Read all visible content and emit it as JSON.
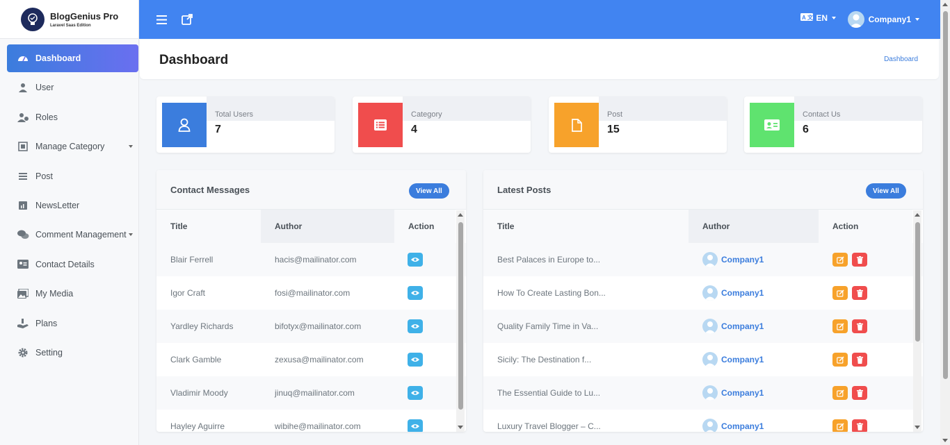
{
  "brand": {
    "name": "BlogGenius Pro",
    "subtitle": "Laravel Saas Edition"
  },
  "sidebar": {
    "items": [
      {
        "label": "Dashboard",
        "icon": "dashboard-icon",
        "active": true
      },
      {
        "label": "User",
        "icon": "user-icon"
      },
      {
        "label": "Roles",
        "icon": "roles-icon"
      },
      {
        "label": "Manage Category",
        "icon": "category-icon",
        "dropdown": true
      },
      {
        "label": "Post",
        "icon": "post-icon"
      },
      {
        "label": "NewsLetter",
        "icon": "newsletter-icon"
      },
      {
        "label": "Comment Management",
        "icon": "comments-icon",
        "dropdown": true
      },
      {
        "label": "Contact Details",
        "icon": "contact-card-icon"
      },
      {
        "label": "My Media",
        "icon": "media-icon"
      },
      {
        "label": "Plans",
        "icon": "plans-icon"
      },
      {
        "label": "Setting",
        "icon": "gear-icon"
      }
    ]
  },
  "header": {
    "language": "EN",
    "user_name": "Company1"
  },
  "page": {
    "title": "Dashboard",
    "breadcrumb": "Dashboard"
  },
  "stats": [
    {
      "label": "Total Users",
      "value": "7",
      "color": "#3b7ddd",
      "icon": "user-outline-icon"
    },
    {
      "label": "Category",
      "value": "4",
      "color": "#f04d4d",
      "icon": "list-icon"
    },
    {
      "label": "Post",
      "value": "15",
      "color": "#f7a22b",
      "icon": "file-icon"
    },
    {
      "label": "Contact Us",
      "value": "6",
      "color": "#5fe36f",
      "icon": "id-card-icon"
    }
  ],
  "contact_messages": {
    "title": "Contact Messages",
    "view_all": "View All",
    "columns": [
      "Title",
      "Author",
      "Action"
    ],
    "rows": [
      {
        "title": "Blair Ferrell",
        "author": "hacis@mailinator.com"
      },
      {
        "title": "Igor Craft",
        "author": "fosi@mailinator.com"
      },
      {
        "title": "Yardley Richards",
        "author": "bifotyx@mailinator.com"
      },
      {
        "title": "Clark Gamble",
        "author": "zexusa@mailinator.com"
      },
      {
        "title": "Vladimir Moody",
        "author": "jinuq@mailinator.com"
      },
      {
        "title": "Hayley Aguirre",
        "author": "wibihe@mailinator.com"
      }
    ]
  },
  "latest_posts": {
    "title": "Latest Posts",
    "view_all": "View All",
    "columns": [
      "Title",
      "Author",
      "Action"
    ],
    "rows": [
      {
        "title": "Best Palaces in Europe to...",
        "author": "Company1"
      },
      {
        "title": "How To Create Lasting Bon...",
        "author": "Company1"
      },
      {
        "title": "Quality Family Time in Va...",
        "author": "Company1"
      },
      {
        "title": "Sicily: The Destination f...",
        "author": "Company1"
      },
      {
        "title": "The Essential Guide to Lu...",
        "author": "Company1"
      },
      {
        "title": "Luxury Travel Blogger – C...",
        "author": "Company1"
      }
    ]
  },
  "colors": {
    "primary": "#4184f1",
    "accent": "#3b7ddd",
    "info": "#3fb1e8",
    "warning": "#f7a22b",
    "danger": "#f04d4d",
    "success": "#5fe36f"
  }
}
